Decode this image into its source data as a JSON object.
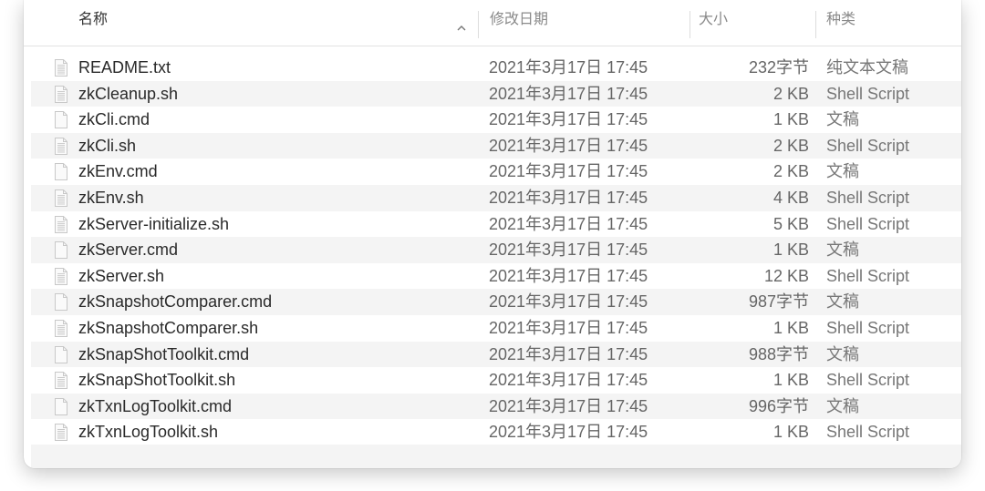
{
  "columns": {
    "name": "名称",
    "date": "修改日期",
    "size": "大小",
    "kind": "种类"
  },
  "sort": {
    "column": "name",
    "direction": "ascending",
    "icon": "chevron-up-icon"
  },
  "files": [
    {
      "name": "README.txt",
      "date": "2021年3月17日 17:45",
      "size": "232字节",
      "kind": "纯文本文稿",
      "icon": "text-file-icon"
    },
    {
      "name": "zkCleanup.sh",
      "date": "2021年3月17日 17:45",
      "size": "2 KB",
      "kind": "Shell Script",
      "icon": "text-file-icon"
    },
    {
      "name": "zkCli.cmd",
      "date": "2021年3月17日 17:45",
      "size": "1 KB",
      "kind": "文稿",
      "icon": "blank-file-icon"
    },
    {
      "name": "zkCli.sh",
      "date": "2021年3月17日 17:45",
      "size": "2 KB",
      "kind": "Shell Script",
      "icon": "text-file-icon"
    },
    {
      "name": "zkEnv.cmd",
      "date": "2021年3月17日 17:45",
      "size": "2 KB",
      "kind": "文稿",
      "icon": "blank-file-icon"
    },
    {
      "name": "zkEnv.sh",
      "date": "2021年3月17日 17:45",
      "size": "4 KB",
      "kind": "Shell Script",
      "icon": "text-file-icon"
    },
    {
      "name": "zkServer-initialize.sh",
      "date": "2021年3月17日 17:45",
      "size": "5 KB",
      "kind": "Shell Script",
      "icon": "text-file-icon"
    },
    {
      "name": "zkServer.cmd",
      "date": "2021年3月17日 17:45",
      "size": "1 KB",
      "kind": "文稿",
      "icon": "blank-file-icon"
    },
    {
      "name": "zkServer.sh",
      "date": "2021年3月17日 17:45",
      "size": "12 KB",
      "kind": "Shell Script",
      "icon": "text-file-icon"
    },
    {
      "name": "zkSnapshotComparer.cmd",
      "date": "2021年3月17日 17:45",
      "size": "987字节",
      "kind": "文稿",
      "icon": "blank-file-icon"
    },
    {
      "name": "zkSnapshotComparer.sh",
      "date": "2021年3月17日 17:45",
      "size": "1 KB",
      "kind": "Shell Script",
      "icon": "text-file-icon"
    },
    {
      "name": "zkSnapShotToolkit.cmd",
      "date": "2021年3月17日 17:45",
      "size": "988字节",
      "kind": "文稿",
      "icon": "blank-file-icon"
    },
    {
      "name": "zkSnapShotToolkit.sh",
      "date": "2021年3月17日 17:45",
      "size": "1 KB",
      "kind": "Shell Script",
      "icon": "text-file-icon"
    },
    {
      "name": "zkTxnLogToolkit.cmd",
      "date": "2021年3月17日 17:45",
      "size": "996字节",
      "kind": "文稿",
      "icon": "blank-file-icon"
    },
    {
      "name": "zkTxnLogToolkit.sh",
      "date": "2021年3月17日 17:45",
      "size": "1 KB",
      "kind": "Shell Script",
      "icon": "text-file-icon"
    }
  ]
}
